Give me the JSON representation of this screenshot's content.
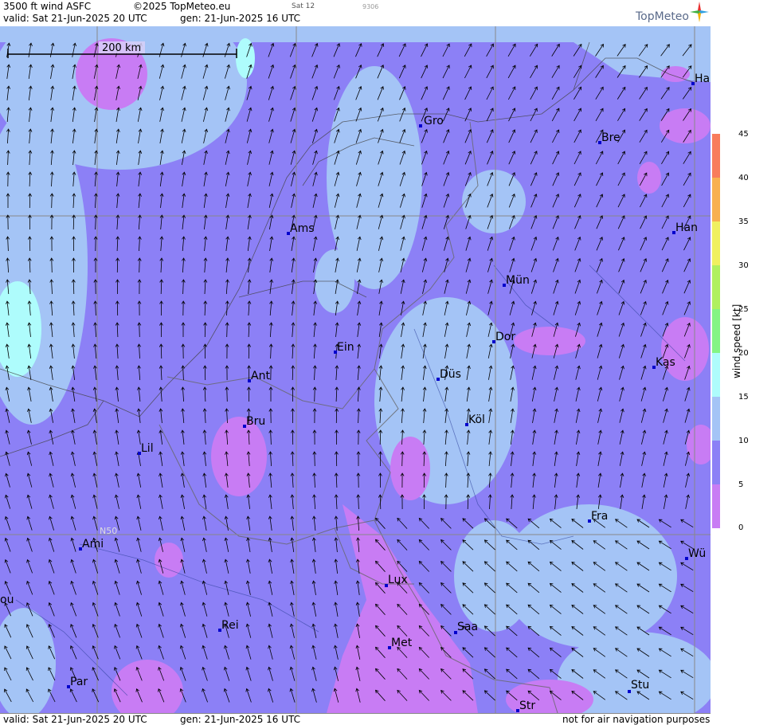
{
  "header": {
    "title": "3500 ft wind ASFC",
    "copyright": "©2025 TopMeteo.eu",
    "day_code": "Sat 12",
    "run_code": "9306",
    "valid": "valid:  Sat  21-Jun-2025  20 UTC",
    "generated": "gen: 21-Jun-2025 16 UTC",
    "logo": "TopMeteo"
  },
  "footer": {
    "valid": "valid:  Sat  21-Jun-2025  20 UTC",
    "generated": "gen: 21-Jun-2025 16 UTC",
    "disclaimer": "not for air navigation purposes"
  },
  "map": {
    "scale_label": "200 km",
    "latitude_label": "N50",
    "cities": [
      {
        "label": "Ha"
      },
      {
        "label": "Gro"
      },
      {
        "label": "Bre"
      },
      {
        "label": "Ams"
      },
      {
        "label": "Han"
      },
      {
        "label": "Mün"
      },
      {
        "label": "Ein"
      },
      {
        "label": "Dor"
      },
      {
        "label": "Kas"
      },
      {
        "label": "Ant"
      },
      {
        "label": "Düs"
      },
      {
        "label": "Bru"
      },
      {
        "label": "Köl"
      },
      {
        "label": "Lil"
      },
      {
        "label": "Fra"
      },
      {
        "label": "Ami"
      },
      {
        "label": "Wü"
      },
      {
        "label": "Lux"
      },
      {
        "label": "ou"
      },
      {
        "label": "Rei"
      },
      {
        "label": "Saa"
      },
      {
        "label": "Met"
      },
      {
        "label": "Par"
      },
      {
        "label": "Stu"
      },
      {
        "label": "Str"
      }
    ]
  },
  "legend": {
    "title": "wind speed [kt]",
    "ticks": [
      "45",
      "40",
      "35",
      "30",
      "25",
      "20",
      "15",
      "10",
      "5",
      "0"
    ],
    "colors": [
      "#c87cf4",
      "#8c80f6",
      "#a4c4f6",
      "#aefcfc",
      "#84f484",
      "#b0f060",
      "#f0f060",
      "#f8b050",
      "#f87c5c"
    ],
    "background_color": "#8c80f6"
  }
}
